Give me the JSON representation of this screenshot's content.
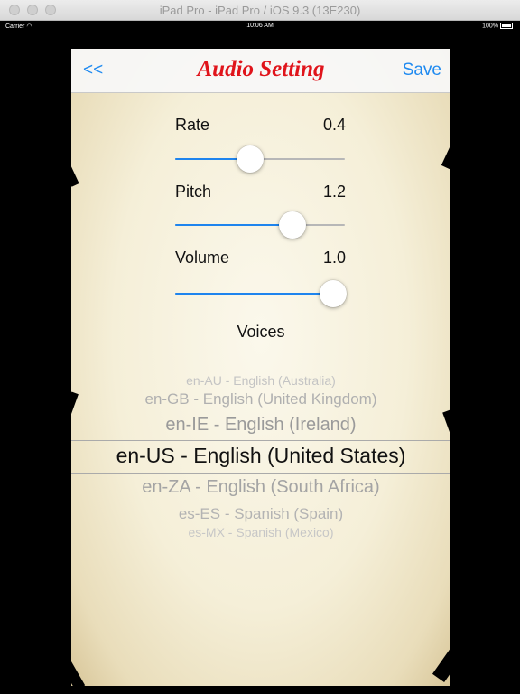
{
  "window": {
    "title": "iPad Pro - iPad Pro / iOS 9.3 (13E230)"
  },
  "status_bar": {
    "carrier": "Carrier",
    "time": "10:06 AM",
    "battery": "100%"
  },
  "nav": {
    "back_label": "<<",
    "title": "Audio Setting",
    "save_label": "Save"
  },
  "settings": [
    {
      "label": "Rate",
      "value": "0.4",
      "fraction": 0.44
    },
    {
      "label": "Pitch",
      "value": "1.2",
      "fraction": 0.69
    },
    {
      "label": "Volume",
      "value": "1.0",
      "fraction": 0.93
    }
  ],
  "voices": {
    "label": "Voices",
    "items": [
      "en-AU - English (Australia)",
      "en-GB - English (United Kingdom)",
      "en-IE - English (Ireland)",
      "en-US - English (United States)",
      "en-ZA - English (South Africa)",
      "es-ES - Spanish (Spain)",
      "es-MX - Spanish (Mexico)"
    ],
    "selected": "en-US - English (United States)"
  },
  "colors": {
    "accent": "#1e84ee",
    "title": "#e0141b"
  }
}
